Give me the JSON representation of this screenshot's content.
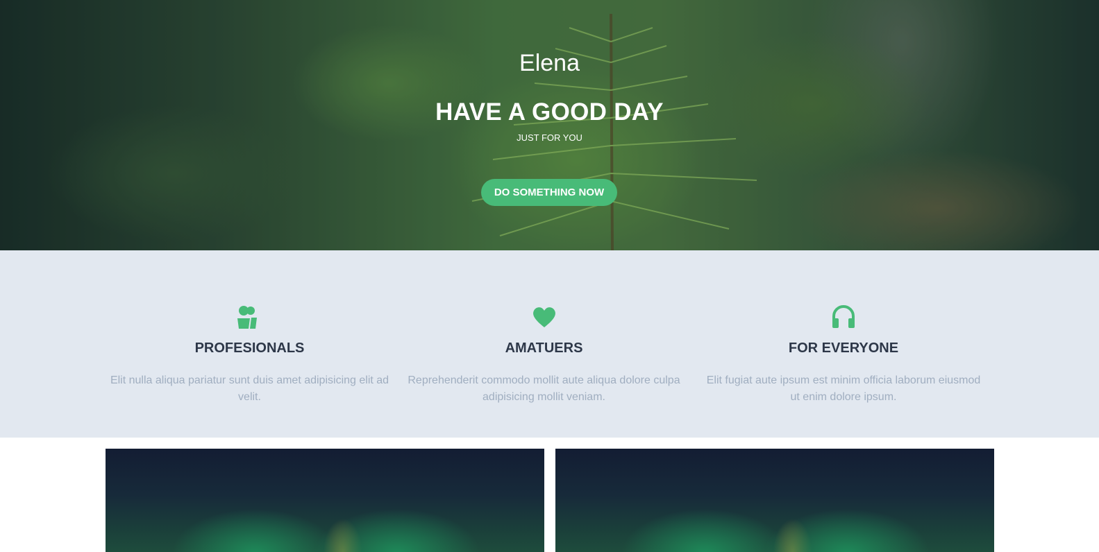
{
  "hero": {
    "brand": "Elena",
    "headline": "HAVE A GOOD DAY",
    "subline": "JUST FOR YOU",
    "cta_label": "DO SOMETHING NOW"
  },
  "features": [
    {
      "icon": "users-icon",
      "title": "PROFESIONALS",
      "text": "Elit nulla aliqua pariatur sunt duis amet adipisicing elit ad velit."
    },
    {
      "icon": "heart-icon",
      "title": "AMATUERS",
      "text": "Reprehenderit commodo mollit aute aliqua dolore culpa adipisicing mollit veniam."
    },
    {
      "icon": "headphones-icon",
      "title": "FOR EVERYONE",
      "text": "Elit fugiat aute ipsum est minim officia laborum eiusmod ut enim dolore ipsum."
    }
  ],
  "colors": {
    "accent": "#48bb78",
    "features_bg": "#e2e8f0",
    "heading": "#2d3748",
    "muted_text": "#a0aec0"
  }
}
